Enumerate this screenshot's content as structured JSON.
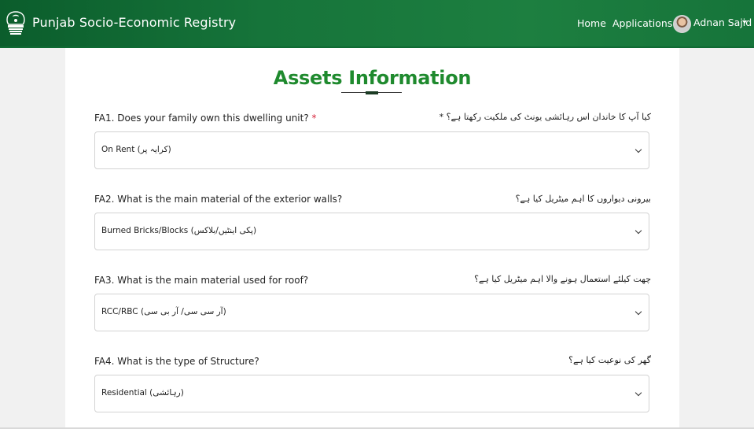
{
  "header": {
    "app_title": "Punjab Socio-Economic Registry",
    "nav": [
      {
        "label": "Home"
      },
      {
        "label": "Applications"
      }
    ],
    "user_name": "Adnan Sajid"
  },
  "page": {
    "title": "Assets Information"
  },
  "questions": [
    {
      "label": "FA1. Does your family own this dwelling unit?",
      "required_marker": "*",
      "urdu": "کیا آپ کا خاندان اس رہائشی یونٹ کی ملکیت رکھتا ہے؟ *",
      "selected": "On Rent (کرایہ پر)"
    },
    {
      "label": "FA2. What is the main material of the exterior walls?",
      "urdu": "بیرونی دیواروں کا اہم میٹریل کیا ہے؟",
      "selected": "Burned Bricks/Blocks (پکی اینٹیں/بلاکس)"
    },
    {
      "label": "FA3. What is the main material used for roof?",
      "urdu": "چھت کیلئے استعمال ہونے والا اہم میٹریل کیا ہے؟",
      "selected": "RCC/RBC (آر سی سی/ آر بی سی)"
    },
    {
      "label": "FA4. What is the type of Structure?",
      "urdu": "گھر کی نوعیت کیا ہے؟",
      "selected": "Residential (رہائشی)"
    }
  ],
  "colors": {
    "header_green": "#16743a",
    "title_green": "#1f8a2e",
    "required_red": "#d7263d"
  },
  "icons": {
    "logo": "punjab-emblem-icon",
    "dropdown": "chevron-down-icon",
    "user_menu": "caret-down-icon"
  }
}
